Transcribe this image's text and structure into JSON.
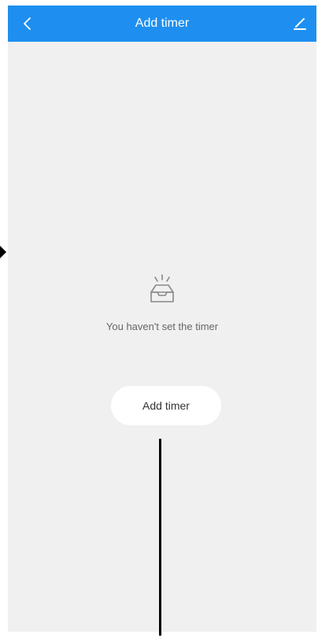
{
  "header": {
    "title": "Add timer",
    "back_icon": "chevron-left-icon",
    "edit_icon": "pencil-icon",
    "color": "#1e8ff0"
  },
  "empty_state": {
    "icon": "empty-tray-icon",
    "message": "You haven't set the timer"
  },
  "actions": {
    "add_timer_label": "Add timer"
  }
}
